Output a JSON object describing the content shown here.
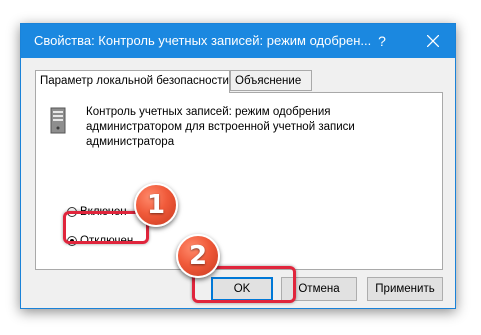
{
  "window": {
    "title": "Свойства: Контроль учетных записей: режим одобрен...",
    "help_label": "?"
  },
  "tabs": [
    {
      "label": "Параметр локальной безопасности",
      "active": true
    },
    {
      "label": "Объяснение",
      "active": false
    }
  ],
  "policy": {
    "icon": "server-computer-icon",
    "description": "Контроль учетных записей: режим одобрения администратором для встроенной учетной записи администратора"
  },
  "options": [
    {
      "label": "Включен",
      "selected": false
    },
    {
      "label": "Отключен",
      "selected": true
    }
  ],
  "buttons": {
    "ok": "OK",
    "cancel": "Отмена",
    "apply": "Применить"
  },
  "callouts": [
    "1",
    "2"
  ],
  "colors": {
    "titlebar": "#1b88e0",
    "highlight": "#e0253c",
    "callout": "#f05a3a",
    "default_button_border": "#0078d7"
  }
}
